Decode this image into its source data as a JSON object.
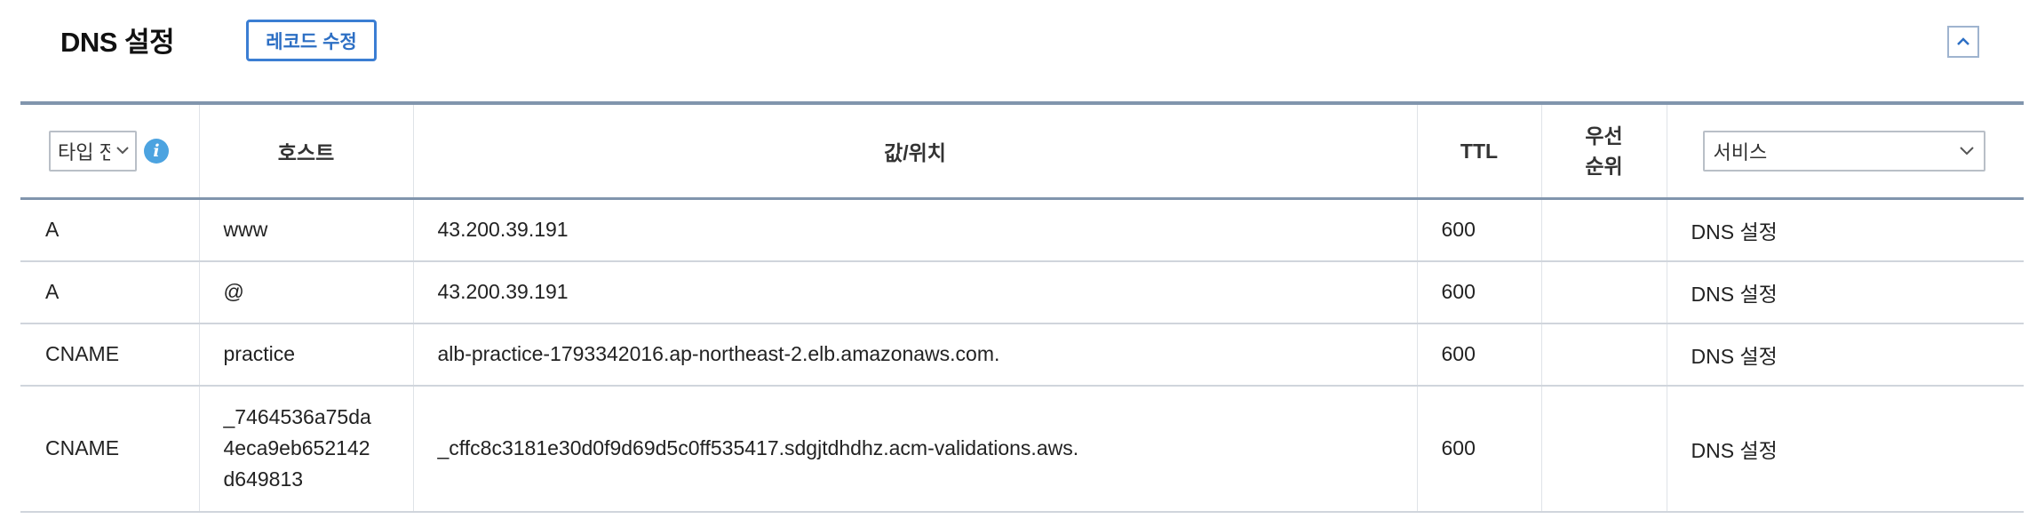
{
  "header": {
    "title": "DNS 설정",
    "edit_button": "레코드 수정"
  },
  "table": {
    "columns": {
      "type_select": "타입 전체",
      "host": "호스트",
      "value": "값/위치",
      "ttl": "TTL",
      "priority_line1": "우선",
      "priority_line2": "순위",
      "service_select": "서비스"
    },
    "rows": [
      {
        "type": "A",
        "host": "www",
        "value": "43.200.39.191",
        "ttl": "600",
        "priority": "",
        "service": "DNS 설정"
      },
      {
        "type": "A",
        "host": "@",
        "value": "43.200.39.191",
        "ttl": "600",
        "priority": "",
        "service": "DNS 설정"
      },
      {
        "type": "CNAME",
        "host": "practice",
        "value": "alb-practice-1793342016.ap-northeast-2.elb.amazonaws.com.",
        "ttl": "600",
        "priority": "",
        "service": "DNS 설정"
      },
      {
        "type": "CNAME",
        "host_lines": [
          "_7464536a75da",
          "4eca9eb652142",
          "d649813"
        ],
        "value": "_cffc8c3181e30d0f9d69d5c0ff535417.sdgjtdhdhz.acm-validations.aws.",
        "ttl": "600",
        "priority": "",
        "service": "DNS 설정"
      }
    ]
  },
  "icons": {
    "info": "info-icon",
    "collapse": "chevron-up-icon",
    "dropdown": "chevron-down-icon"
  },
  "colors": {
    "accent": "#3b7ed3",
    "header_rule": "#8195ad",
    "info": "#4ca3e0"
  }
}
